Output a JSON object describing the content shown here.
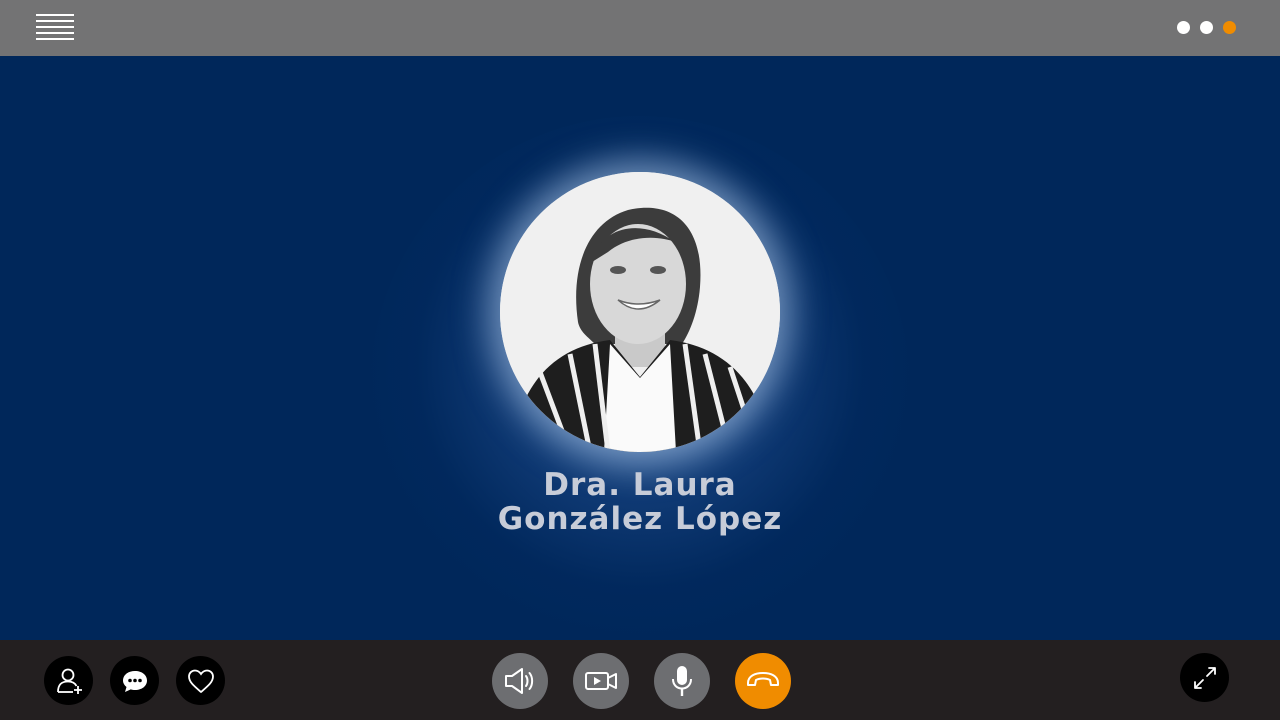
{
  "contact": {
    "title_line": "Dra. Laura",
    "name_line": "González López"
  },
  "pagination": {
    "total": 3,
    "active_index": 2
  },
  "icons": {
    "menu": "hamburger-menu-icon",
    "add_contact": "add-person-icon",
    "chat": "chat-bubble-icon",
    "favorite": "heart-icon",
    "speaker": "speaker-icon",
    "video": "video-camera-icon",
    "microphone": "microphone-icon",
    "hang_up": "phone-hangup-icon",
    "fullscreen": "expand-icon"
  },
  "colors": {
    "background": "#00275a",
    "top_bar": "#737374",
    "bottom_bar": "#231f20",
    "accent": "#f08c00",
    "control_grey": "#6d6e71",
    "name_text": "#c7ccd8"
  }
}
